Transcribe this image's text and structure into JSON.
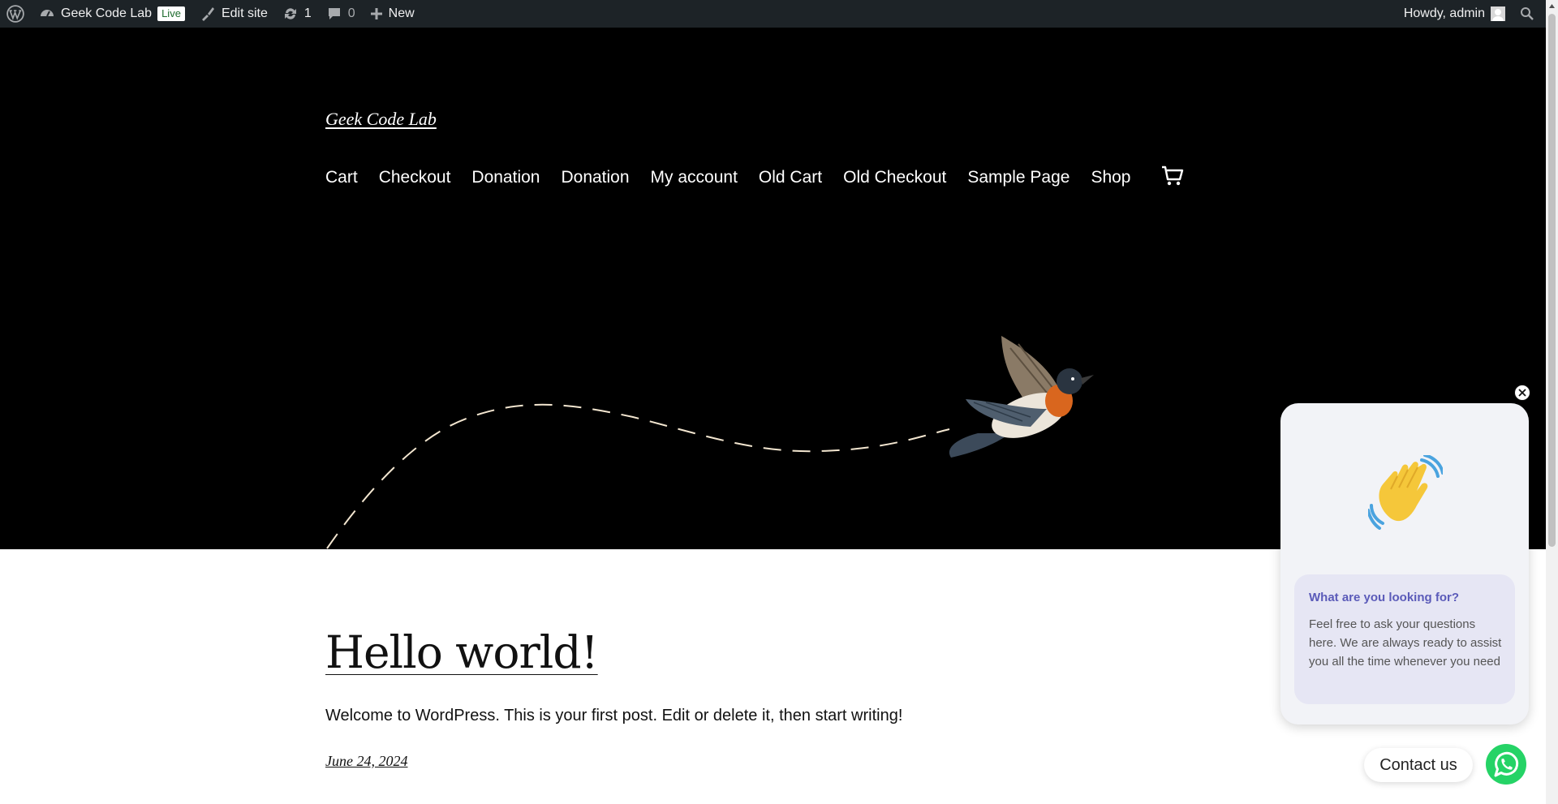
{
  "adminbar": {
    "site_name": "Geek Code Lab",
    "live_badge": "Live",
    "edit_site": "Edit site",
    "updates_count": "1",
    "comments_count": "0",
    "new_label": "New",
    "howdy": "Howdy, admin"
  },
  "header": {
    "site_title": "Geek Code Lab",
    "nav": {
      "items": [
        "Cart",
        "Checkout",
        "Donation",
        "Donation",
        "My account",
        "Old Cart",
        "Old Checkout",
        "Sample Page",
        "Shop"
      ]
    }
  },
  "post": {
    "title": "Hello world!",
    "excerpt": "Welcome to WordPress. This is your first post. Edit or delete it, then start writing!",
    "date": "June 24, 2024"
  },
  "chat": {
    "heading": "What are you looking for?",
    "text": "Feel free to ask your questions here. We are always ready to assist you all the time whenever you need",
    "contact_label": "Contact us"
  },
  "colors": {
    "adminbar_bg": "#1d2327",
    "hero_bg": "#000000",
    "chat_heading": "#5b5bb9",
    "whatsapp_green": "#25d366"
  }
}
